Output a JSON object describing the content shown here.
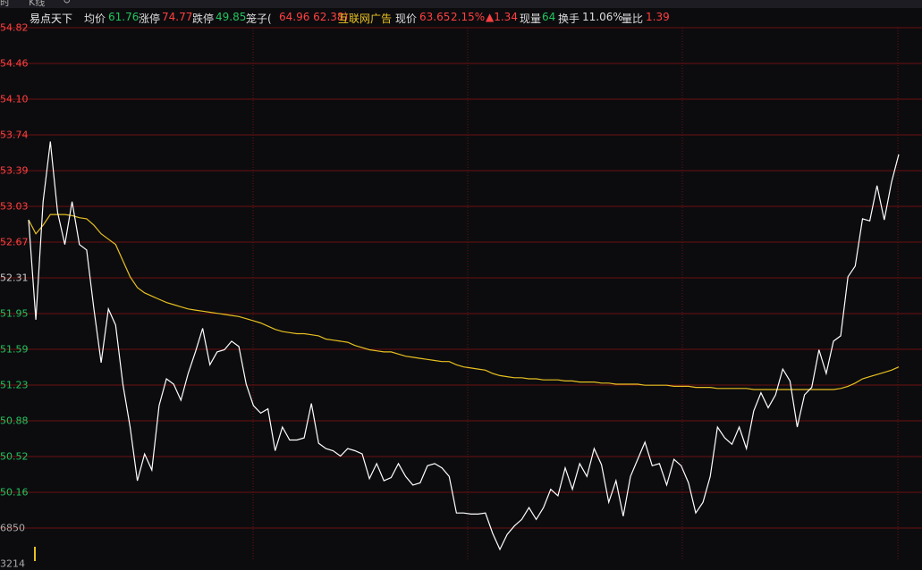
{
  "tabs": [
    "时",
    "K线",
    "↻"
  ],
  "info": {
    "name": "易点天下",
    "avg_label": "均价",
    "avg": "61.76",
    "limit_up_label": "涨停",
    "limit_up": "74.77",
    "limit_down_label": "跌停",
    "limit_down": "49.85",
    "cage_label": "笼子(",
    "cage": "64.96 62.38)",
    "sector": "互联网广告",
    "price_label": "现价",
    "price": "63.65",
    "pct": "2.15%",
    "change": "▲1.34",
    "vol_label": "现量",
    "vol": "64",
    "turnover_label": "换手",
    "turnover": "11.06%",
    "ratio_label": "量比",
    "ratio": "1.39"
  },
  "y_labels": [
    "54.82",
    "54.46",
    "54.10",
    "53.74",
    "53.39",
    "53.03",
    "52.67",
    "52.31",
    "51.95",
    "51.59",
    "51.23",
    "50.88",
    "50.52",
    "50.16",
    "6850",
    "3214"
  ],
  "colors": {
    "up": "#ff4040",
    "down": "#22c55e",
    "avg_line": "#e8c020",
    "price_line": "#ffffff",
    "grid": "#6b0f0f"
  },
  "chart_data": {
    "type": "line",
    "ylim": [
      60.16,
      64.82
    ],
    "series": [
      {
        "values": [
          63.03,
          62.1,
          63.2,
          63.76,
          63.1,
          62.8,
          63.2,
          62.8,
          62.75,
          62.2,
          61.7,
          62.2,
          62.05,
          61.5,
          61.1,
          60.6,
          60.85,
          60.7,
          61.3,
          61.55,
          61.5,
          61.35,
          61.6,
          61.8,
          62.02,
          61.68,
          61.8,
          61.82,
          61.9,
          61.85,
          61.5,
          61.3,
          61.23,
          61.27,
          60.88,
          61.1,
          60.98,
          60.98,
          61.0,
          61.32,
          60.95,
          60.9,
          60.88,
          60.83,
          60.9,
          60.88,
          60.85,
          60.62,
          60.76,
          60.6,
          60.63,
          60.76,
          60.64,
          60.56,
          60.58,
          60.74,
          60.76,
          60.72,
          60.64,
          60.3,
          60.3,
          60.29,
          60.29,
          60.3,
          60.11,
          59.96,
          60.1,
          60.18,
          60.24,
          60.35,
          60.24,
          60.35,
          60.52,
          60.46,
          60.72,
          60.52,
          60.76,
          60.64,
          60.9,
          60.75,
          60.4,
          60.6,
          60.27,
          60.64,
          60.8,
          60.96,
          60.74,
          60.76,
          60.56,
          60.8,
          60.74,
          60.58,
          60.3,
          60.4,
          60.64,
          61.1,
          61.0,
          60.94,
          61.1,
          60.9,
          61.25,
          61.42,
          61.28,
          61.4,
          61.64,
          61.53,
          61.1,
          61.4,
          61.47,
          61.82,
          61.6,
          61.9,
          61.95,
          62.5,
          62.6,
          63.04,
          63.02,
          63.35,
          63.03,
          63.38,
          63.64
        ]
      },
      {
        "values": [
          63.03,
          62.9,
          62.98,
          63.08,
          63.08,
          63.08,
          63.07,
          63.05,
          63.04,
          62.98,
          62.9,
          62.85,
          62.8,
          62.65,
          62.5,
          62.4,
          62.35,
          62.32,
          62.29,
          62.26,
          62.24,
          62.22,
          62.2,
          62.19,
          62.18,
          62.17,
          62.16,
          62.15,
          62.14,
          62.13,
          62.11,
          62.09,
          62.07,
          62.04,
          62.01,
          61.99,
          61.98,
          61.97,
          61.97,
          61.96,
          61.95,
          61.92,
          61.91,
          61.9,
          61.89,
          61.86,
          61.84,
          61.82,
          61.81,
          61.8,
          61.8,
          61.78,
          61.76,
          61.75,
          61.74,
          61.73,
          61.72,
          61.71,
          61.71,
          61.68,
          61.66,
          61.65,
          61.64,
          61.63,
          61.6,
          61.58,
          61.57,
          61.56,
          61.56,
          61.55,
          61.55,
          61.54,
          61.54,
          61.54,
          61.53,
          61.53,
          61.52,
          61.52,
          61.52,
          61.51,
          61.51,
          61.5,
          61.5,
          61.5,
          61.5,
          61.49,
          61.49,
          61.49,
          61.49,
          61.48,
          61.48,
          61.48,
          61.47,
          61.47,
          61.47,
          61.46,
          61.46,
          61.46,
          61.46,
          61.46,
          61.45,
          61.45,
          61.45,
          61.45,
          61.45,
          61.45,
          61.45,
          61.45,
          61.45,
          61.45,
          61.45,
          61.45,
          61.46,
          61.48,
          61.51,
          61.55,
          61.57,
          61.59,
          61.61,
          61.63,
          61.66
        ]
      }
    ]
  }
}
